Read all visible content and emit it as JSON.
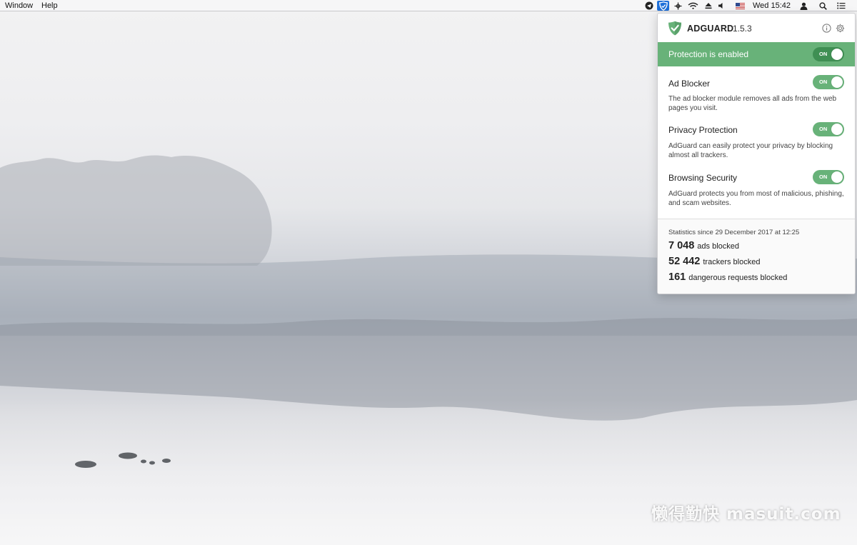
{
  "menubar": {
    "items": [
      "Window",
      "Help"
    ],
    "status_icons": [
      "telegram-icon",
      "adguard-icon",
      "network-icon",
      "wifi-icon",
      "eject-icon",
      "volume-icon",
      "us-flag-icon"
    ],
    "clock": "Wed 15:42",
    "right_icons": [
      "user-icon",
      "search-icon",
      "list-icon"
    ]
  },
  "popup": {
    "brand": "ADGUARD",
    "version": "1.5.3",
    "accent_color": "#68b279",
    "protection": {
      "label": "Protection is enabled",
      "toggle": "ON"
    },
    "modules": [
      {
        "title": "Ad Blocker",
        "description": "The ad blocker module removes all ads from the web pages you visit.",
        "toggle": "ON"
      },
      {
        "title": "Privacy Protection",
        "description": "AdGuard can easily protect your privacy by blocking almost all trackers.",
        "toggle": "ON"
      },
      {
        "title": "Browsing Security",
        "description": "AdGuard protects you from most of malicious, phishing, and scam websites.",
        "toggle": "ON"
      }
    ],
    "stats": {
      "since": "Statistics since 29 December 2017 at 12:25",
      "items": [
        {
          "value": "7 048",
          "label": "ads blocked"
        },
        {
          "value": "52 442",
          "label": "trackers blocked"
        },
        {
          "value": "161",
          "label": "dangerous requests blocked"
        }
      ]
    }
  },
  "watermark": "懒得勤快  masuit.com"
}
